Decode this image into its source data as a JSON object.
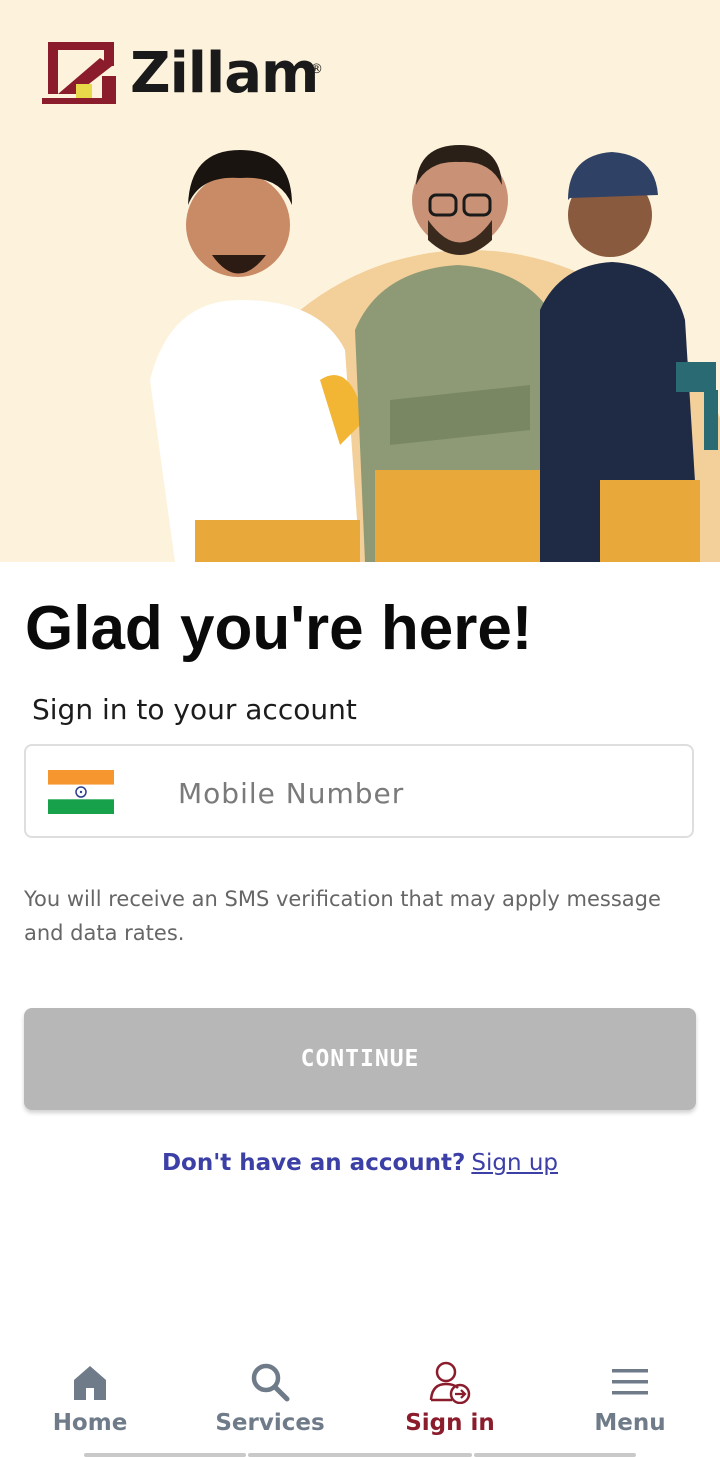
{
  "brand": {
    "name": "Zillam",
    "registered_mark": "®"
  },
  "main": {
    "title": "Glad you're here!",
    "subtitle": "Sign in to your account",
    "phone": {
      "placeholder": "Mobile Number",
      "value": "",
      "country_flag": "india-flag-icon"
    },
    "sms_note": "You will receive an SMS verification that may apply message and data rates.",
    "continue_label": "CONTINUE",
    "signup_prompt": "Don't have an account?",
    "signup_link": "Sign up"
  },
  "nav": {
    "items": [
      {
        "label": "Home",
        "icon": "home-icon",
        "active": false
      },
      {
        "label": "Services",
        "icon": "search-icon",
        "active": false
      },
      {
        "label": "Sign in",
        "icon": "user-signin-icon",
        "active": true
      },
      {
        "label": "Menu",
        "icon": "menu-icon",
        "active": false
      }
    ]
  },
  "colors": {
    "hero_bg": "#fdf3dc",
    "brand_maroon": "#8b1c2c",
    "logo_yellow": "#e8d94a",
    "link_blue": "#3b3fa6",
    "button_disabled": "#b7b7b7",
    "nav_inactive": "#6f7b89"
  }
}
